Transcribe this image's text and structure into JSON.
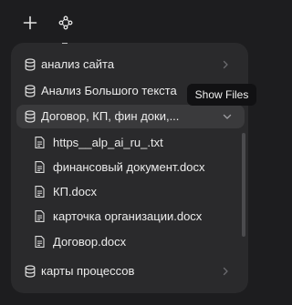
{
  "toolbar": {
    "add_icon": "plus-icon",
    "graph_icon": "nodes-icon"
  },
  "list": {
    "items": [
      {
        "label": "анализ сайта",
        "icon": "database-icon",
        "chevron": "chevron-right-icon"
      },
      {
        "label": "Анализ Большого текста",
        "icon": "database-icon",
        "chevron": "chevron-right-icon"
      },
      {
        "label": "Договор, КП, фин доки,...",
        "icon": "database-icon",
        "chevron": "chevron-down-icon",
        "expanded": true
      },
      {
        "label": "карты процессов",
        "icon": "database-icon",
        "chevron": "chevron-right-icon"
      }
    ],
    "files": [
      {
        "label": "https__alp_ai_ru_.txt",
        "icon": "file-icon"
      },
      {
        "label": "финансовый документ.docx",
        "icon": "file-icon"
      },
      {
        "label": "КП.docx",
        "icon": "file-icon"
      },
      {
        "label": "карточка организации.docx",
        "icon": "file-icon"
      },
      {
        "label": "Договор.docx",
        "icon": "file-icon"
      }
    ]
  },
  "tooltip": {
    "text": "Show Files"
  },
  "colors": {
    "background": "#1d1d1f",
    "panel": "#2a2a2c",
    "selected": "#3a3a3c",
    "tooltip": "#111113",
    "text": "#ececec"
  }
}
